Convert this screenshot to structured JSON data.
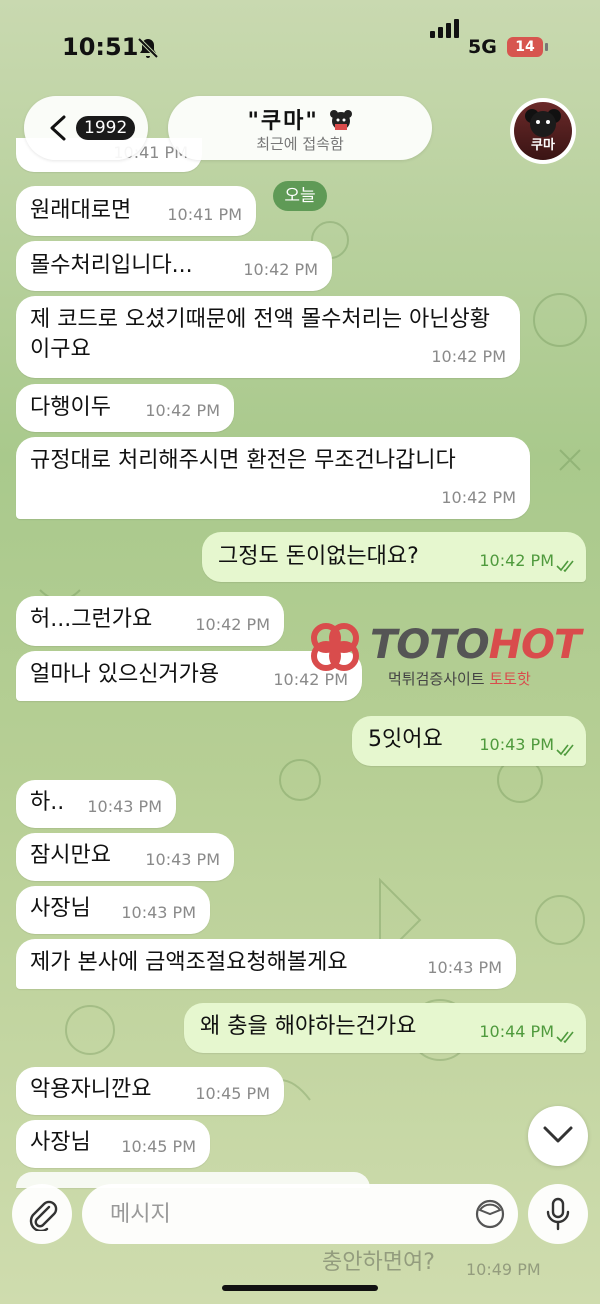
{
  "status_bar": {
    "time": "10:51",
    "network": "5G",
    "battery": "14"
  },
  "header": {
    "back_count": "1992",
    "title": "\"쿠마\"",
    "subtitle": "최근에 접속함",
    "avatar_label": "쿠마"
  },
  "date_chip": "오늘",
  "messages": [
    {
      "text": "원래대로면",
      "time": "10:41 PM"
    },
    {
      "text": "몰수처리입니다...",
      "time": "10:42 PM"
    },
    {
      "text": "제 코드로 오셨기때문에 전액 몰수처리는 아닌상황이구요",
      "time": "10:42 PM"
    },
    {
      "text": "다행이두",
      "time": "10:42 PM"
    },
    {
      "text": "규정대로 처리해주시면 환전은 무조건나갑니다",
      "time": "10:42 PM"
    },
    {
      "text": "그정도 돈이없는대요?",
      "time": "10:42 PM"
    },
    {
      "text": "허...그런가요",
      "time": "10:42 PM"
    },
    {
      "text": "얼마나 있으신거가용",
      "time": "10:42 PM"
    },
    {
      "text": "5잇어요",
      "time": "10:43 PM"
    },
    {
      "text": "하..",
      "time": "10:43 PM"
    },
    {
      "text": "잠시만요",
      "time": "10:43 PM"
    },
    {
      "text": "사장님",
      "time": "10:43 PM"
    },
    {
      "text": "제가 본사에 금액조절요청해볼게요",
      "time": "10:43 PM"
    },
    {
      "text": "왜 충을 해야하는건가요",
      "time": "10:44 PM"
    },
    {
      "text": "악용자니깐요",
      "time": "10:45 PM"
    },
    {
      "text": "사장님",
      "time": "10:45 PM"
    }
  ],
  "partial_top_time": "10:41 PM",
  "ghost_bottom": {
    "text": "충안하면여?",
    "time": "10:49 PM"
  },
  "watermark": {
    "brand_a": "TOTO",
    "brand_b": "HOT",
    "sub_a": "먹튀검증사이트 ",
    "sub_b": "토토핫"
  },
  "composer": {
    "placeholder": "메시지"
  },
  "colors": {
    "outgoing_bubble": "#e6f7cf",
    "incoming_bubble": "#ffffff",
    "date_chip": "#5f9a56",
    "accent_red": "#d94c4c"
  }
}
